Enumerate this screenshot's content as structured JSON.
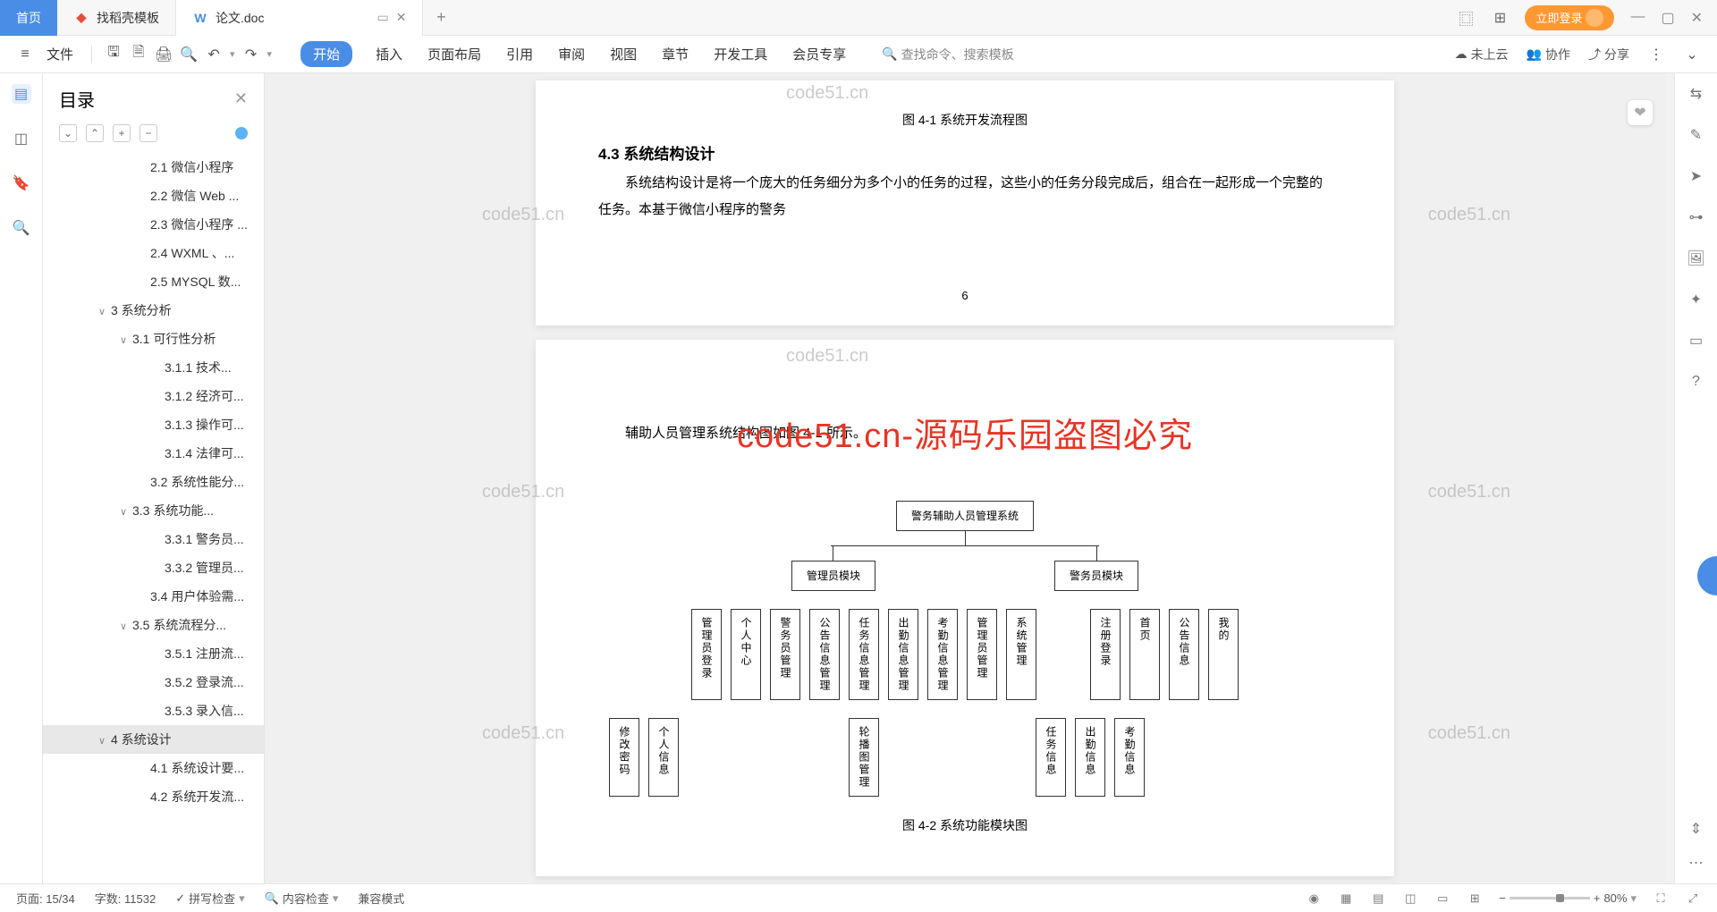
{
  "tabs": {
    "home": "首页",
    "t1": "找稻壳模板",
    "t2": "论文.doc"
  },
  "titleright": {
    "login": "立即登录"
  },
  "toolbar": {
    "file": "文件",
    "ribbon": [
      "开始",
      "插入",
      "页面布局",
      "引用",
      "审阅",
      "视图",
      "章节",
      "开发工具",
      "会员专享"
    ],
    "search": "查找命令、搜索模板",
    "cloud": "未上云",
    "collab": "协作",
    "share": "分享"
  },
  "outline": {
    "title": "目录",
    "items": [
      {
        "pad": 120,
        "chev": "",
        "label": "2.1 微信小程序"
      },
      {
        "pad": 120,
        "chev": "",
        "label": "2.2 微信 Web ..."
      },
      {
        "pad": 120,
        "chev": "",
        "label": "2.3 微信小程序 ..."
      },
      {
        "pad": 120,
        "chev": "",
        "label": "2.4 WXML 、..."
      },
      {
        "pad": 120,
        "chev": "",
        "label": "2.5 MYSQL 数..."
      },
      {
        "pad": 76,
        "chev": "∨",
        "label": "3 系统分析"
      },
      {
        "pad": 100,
        "chev": "∨",
        "label": "3.1 可行性分析"
      },
      {
        "pad": 136,
        "chev": "",
        "label": "3.1.1 技术..."
      },
      {
        "pad": 136,
        "chev": "",
        "label": "3.1.2 经济可..."
      },
      {
        "pad": 136,
        "chev": "",
        "label": "3.1.3 操作可..."
      },
      {
        "pad": 136,
        "chev": "",
        "label": "3.1.4 法律可..."
      },
      {
        "pad": 120,
        "chev": "",
        "label": "3.2 系统性能分..."
      },
      {
        "pad": 100,
        "chev": "∨",
        "label": "3.3  系统功能..."
      },
      {
        "pad": 136,
        "chev": "",
        "label": "3.3.1 警务员..."
      },
      {
        "pad": 136,
        "chev": "",
        "label": "3.3.2 管理员..."
      },
      {
        "pad": 120,
        "chev": "",
        "label": "3.4 用户体验需..."
      },
      {
        "pad": 100,
        "chev": "∨",
        "label": "3.5 系统流程分..."
      },
      {
        "pad": 136,
        "chev": "",
        "label": "3.5.1 注册流..."
      },
      {
        "pad": 136,
        "chev": "",
        "label": "3.5.2 登录流..."
      },
      {
        "pad": 136,
        "chev": "",
        "label": "3.5.3 录入信..."
      },
      {
        "pad": 76,
        "chev": "∨",
        "label": "4 系统设计",
        "sel": true
      },
      {
        "pad": 120,
        "chev": "",
        "label": "4.1 系统设计要..."
      },
      {
        "pad": 120,
        "chev": "",
        "label": "4.2 系统开发流..."
      }
    ]
  },
  "doc": {
    "caption1": "图 4-1  系统开发流程图",
    "h3": "4.3 系统结构设计",
    "p1": "系统结构设计是将一个庞大的任务细分为多个小的任务的过程，这些小的任务分段完成后，组合在一起形成一个完整的任务。本基于微信小程序的警务",
    "pagenum": "6",
    "p2": "辅助人员管理系统结构图如图 4-1 所示。",
    "caption2": "图 4-2  系统功能模块图",
    "overlay": "code51.cn-源码乐园盗图必究",
    "wm": "code51.cn"
  },
  "chart_data": {
    "type": "diagram",
    "title": "警务辅助人员管理系统",
    "root": "警务辅助人员管理系统",
    "modules": [
      {
        "name": "管理员模块",
        "children": [
          "管理员登录",
          "个人中心",
          "警务员管理",
          "公告信息管理",
          "任务信息管理",
          "出勤信息管理",
          "考勤信息管理",
          "管理员管理",
          "系统管理"
        ],
        "sub": {
          "管理员登录": [
            "修改密码",
            "个人信息"
          ],
          "系统管理": [
            "轮播图管理"
          ]
        }
      },
      {
        "name": "警务员模块",
        "children": [
          "注册登录",
          "首页",
          "公告信息",
          "我的"
        ],
        "sub": {
          "我的": [
            "任务信息",
            "出勤信息",
            "考勤信息"
          ]
        }
      }
    ]
  },
  "status": {
    "page": "页面: 15/34",
    "words": "字数: 11532",
    "spell": "拼写检查",
    "content": "内容检查",
    "compat": "兼容模式",
    "zoom": "80%"
  }
}
